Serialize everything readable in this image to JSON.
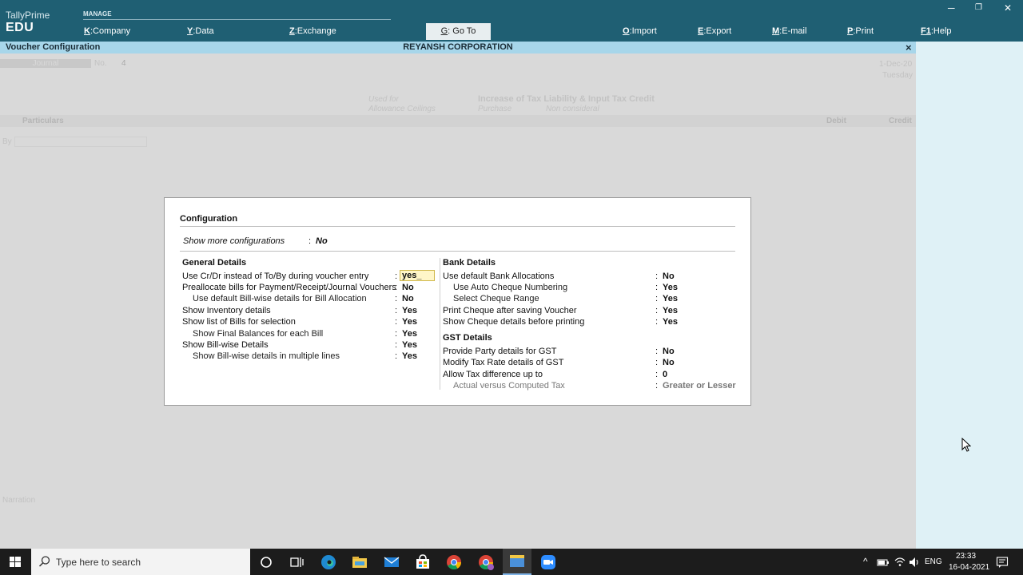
{
  "brand": {
    "name": "TallyPrime",
    "edition": "EDU"
  },
  "menu": {
    "section": "MANAGE",
    "items": [
      {
        "key": "K",
        "label": "Company"
      },
      {
        "key": "Y",
        "label": "Data"
      },
      {
        "key": "Z",
        "label": "Exchange"
      },
      {
        "key": "G",
        "label": "Go To"
      },
      {
        "key": "O",
        "label": "Import"
      },
      {
        "key": "E",
        "label": "Export"
      },
      {
        "key": "M",
        "label": "E-mail"
      },
      {
        "key": "P",
        "label": "Print"
      },
      {
        "key": "F1",
        "label": "Help"
      }
    ]
  },
  "window_controls": {
    "minimize": "─",
    "restore": "❐",
    "close": "✕"
  },
  "titlebar": {
    "left": "Voucher Configuration",
    "center": "REYANSH CORPORATION",
    "close": "×"
  },
  "background_voucher": {
    "type": "Journal",
    "no_label": "No.",
    "no_value": "4",
    "date": "1-Dec-20",
    "day": "Tuesday",
    "used_for_label": "Used for",
    "used_for_sub": "Allowance Ceilings",
    "used_for_value": "Increase of Tax Liability & Input Tax Credit",
    "used_for_value_sub": "Purchase",
    "used_for_value_sub2": "Non consideral",
    "particulars": "Particulars",
    "debit": "Debit",
    "credit": "Credit",
    "by": "By",
    "narration": "Narration"
  },
  "dialog": {
    "title": "Configuration",
    "show_more": {
      "label": "Show more configurations",
      "value": "No"
    },
    "general": {
      "heading": "General Details",
      "rows": [
        {
          "label": "Use Cr/Dr instead of To/By during voucher entry",
          "value": "yes_"
        },
        {
          "label": "Preallocate bills for Payment/Receipt/Journal Vouchers",
          "value": "No"
        },
        {
          "label": "Use default Bill-wise details for Bill Allocation",
          "value": "No"
        },
        {
          "label": "Show Inventory details",
          "value": "Yes"
        },
        {
          "label": "Show list of Bills for selection",
          "value": "Yes"
        },
        {
          "label": "Show Final Balances for each Bill",
          "value": "Yes"
        },
        {
          "label": "Show Bill-wise Details",
          "value": "Yes"
        },
        {
          "label": "Show Bill-wise details in multiple lines",
          "value": "Yes"
        }
      ]
    },
    "bank": {
      "heading": "Bank Details",
      "rows": [
        {
          "label": "Use default Bank Allocations",
          "value": "No"
        },
        {
          "label": "Use Auto Cheque Numbering",
          "value": "Yes"
        },
        {
          "label": "Select Cheque Range",
          "value": "Yes"
        },
        {
          "label": "Print Cheque after saving Voucher",
          "value": "Yes"
        },
        {
          "label": "Show Cheque details before printing",
          "value": "Yes"
        }
      ]
    },
    "gst": {
      "heading": "GST Details",
      "rows": [
        {
          "label": "Provide Party details for GST",
          "value": "No"
        },
        {
          "label": "Modify Tax Rate details of GST",
          "value": "No"
        },
        {
          "label": "Allow Tax difference up to",
          "value": "0"
        },
        {
          "label": "Actual versus Computed Tax",
          "value": "Greater or Lesser"
        }
      ]
    },
    "colon": ":"
  },
  "taskbar": {
    "search_placeholder": "Type here to search",
    "language": "ENG",
    "time": "23:33",
    "date": "16-04-2021"
  }
}
